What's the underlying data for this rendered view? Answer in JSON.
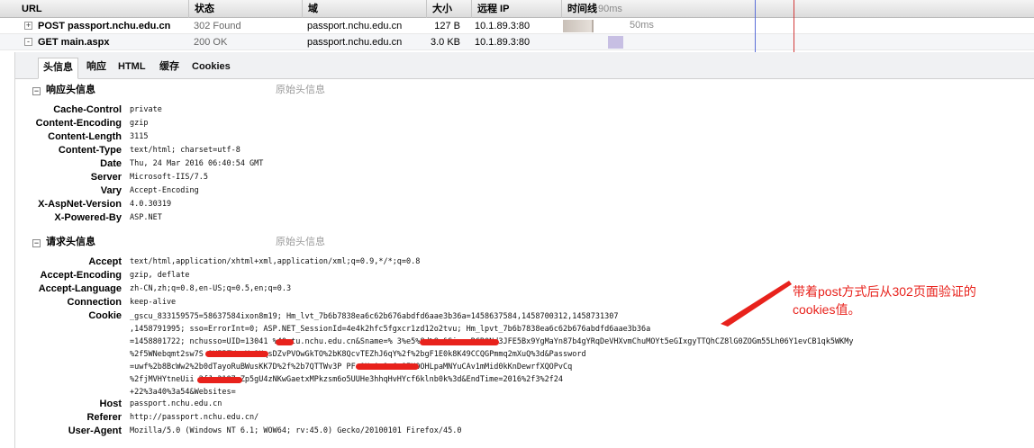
{
  "columns": {
    "url": "URL",
    "status": "状态",
    "domain": "域",
    "size": "大小",
    "remote_ip": "远程 IP",
    "timeline": "时间线"
  },
  "requests": [
    {
      "expander": "+",
      "method_url": "POST passport.nchu.edu.cn",
      "status": "302 Found",
      "domain": "passport.nchu.edu.cn",
      "size": "127 B",
      "ip": "10.1.89.3:80",
      "time": "90ms"
    },
    {
      "expander": "-",
      "method_url": "GET main.aspx",
      "status": "200 OK",
      "domain": "passport.nchu.edu.cn",
      "size": "3.0 KB",
      "ip": "10.1.89.3:80",
      "time": "50ms"
    }
  ],
  "tabs": [
    "头信息",
    "响应",
    "HTML",
    "缓存",
    "Cookies"
  ],
  "response_section": {
    "title": "响应头信息",
    "raw_link": "原始头信息",
    "headers": [
      {
        "name": "Cache-Control",
        "value": "private"
      },
      {
        "name": "Content-Encoding",
        "value": "gzip"
      },
      {
        "name": "Content-Length",
        "value": "3115"
      },
      {
        "name": "Content-Type",
        "value": "text/html; charset=utf-8"
      },
      {
        "name": "Date",
        "value": "Thu, 24 Mar 2016 06:40:54 GMT"
      },
      {
        "name": "Server",
        "value": "Microsoft-IIS/7.5"
      },
      {
        "name": "Vary",
        "value": "Accept-Encoding"
      },
      {
        "name": "X-AspNet-Version",
        "value": "4.0.30319"
      },
      {
        "name": "X-Powered-By",
        "value": "ASP.NET"
      }
    ]
  },
  "request_section": {
    "title": "请求头信息",
    "raw_link": "原始头信息",
    "headers": [
      {
        "name": "Accept",
        "value": "text/html,application/xhtml+xml,application/xml;q=0.9,*/*;q=0.8"
      },
      {
        "name": "Accept-Encoding",
        "value": "gzip, deflate"
      },
      {
        "name": "Accept-Language",
        "value": "zh-CN,zh;q=0.8,en-US;q=0.5,en;q=0.3"
      },
      {
        "name": "Connection",
        "value": "keep-alive"
      }
    ],
    "cookie_name": "Cookie",
    "cookie_lines": [
      "_gscu_833159575=58637584ixon8m19; Hm_lvt_7b6b7838ea6c62b676abdfd6aae3b36a=1458637584,1458700312,1458731307",
      ",1458791995; sso=ErrorInt=0; ASP.NET_SessionId=4e4k2hfc5fgxcr1zd12o2tvu; Hm_lpvt_7b6b7838ea6c62b676abdfd6aae3b36a",
      "=1458801722; nchusso=UID=13041      %40stu.nchu.edu.cn&Sname=%                 3%e5%8d%8e&Sign=RCBONd3JFE5Bx9YgMaYn87b4gYRqDeVHXvmChuMOYt5eGIxgyTTQhCZ8lG0ZOGm55Lh06Y1evCB1qk5WKMy",
      "%2f5WNebqmt2sw7S              9XI5ZWwvKe9UqsDZvPVOwGkTO%2bK8QcvTEZhJ6qY%2f%2bgF1E0k8K49CCQGPmmq2mXuQ%3d&Password",
      "=uwf%2b8BcWw2%2b0dTayoRuBWusKK7D%2f%2b7QTTWv3P          PFoOUsAa1nGc8IHOOHLpaMNYuCAv1mMid0kKnDewrfXQOPvCq",
      "%2fjMVHYtneUii          2fJm31Q7qZp5gU4zNKwGaetxMPkzsm6o5UUHe3hhqHvHYcf6klnb0k%3d&EndTime=2016%2f3%2f24",
      "+22%3a40%3a54&Websites="
    ],
    "trailing_headers": [
      {
        "name": "Host",
        "value": "passport.nchu.edu.cn"
      },
      {
        "name": "Referer",
        "value": "http://passport.nchu.edu.cn/"
      },
      {
        "name": "User-Agent",
        "value": "Mozilla/5.0 (Windows NT 6.1; WOW64; rv:45.0) Gecko/20100101 Firefox/45.0"
      }
    ]
  },
  "annotation": {
    "line1": "带着post方式后从302页面验证的",
    "line2": "cookies值。",
    "color": "#e8221c"
  }
}
